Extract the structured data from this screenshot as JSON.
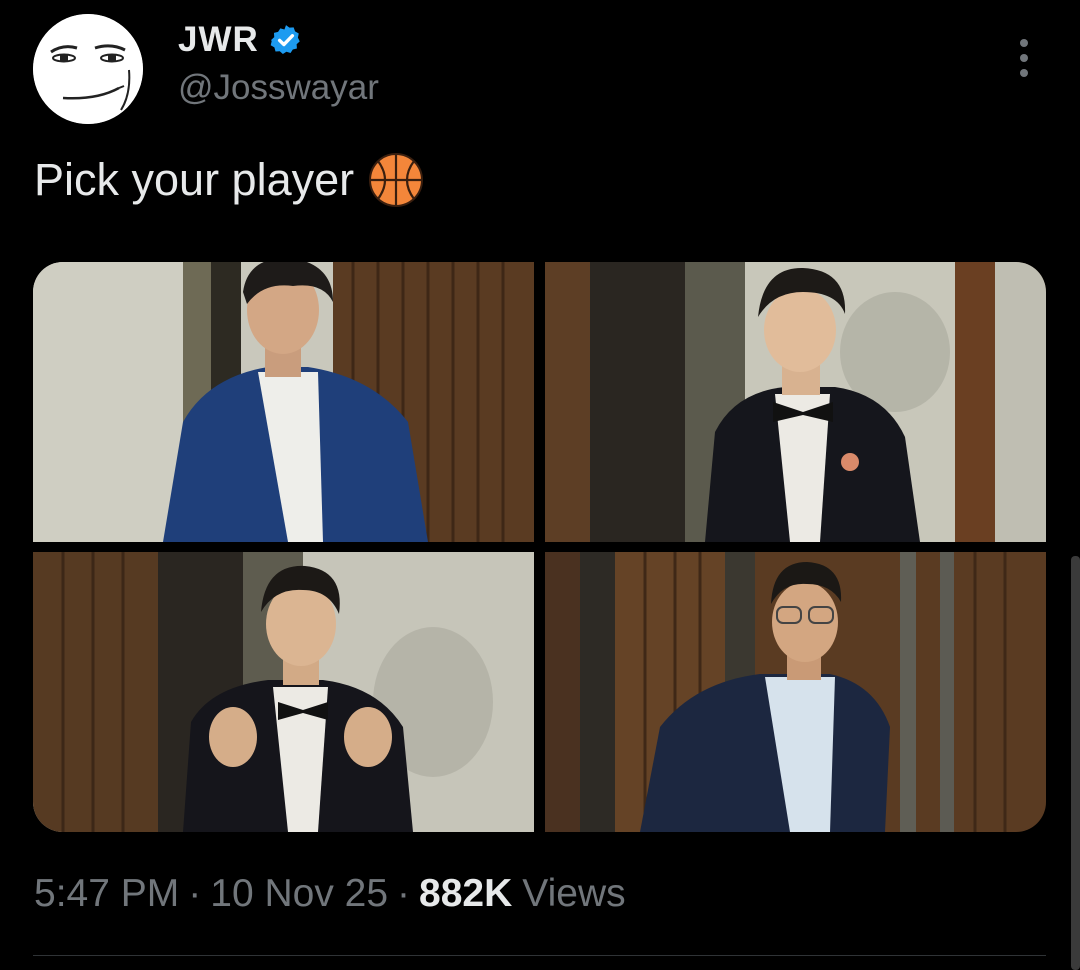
{
  "author": {
    "display_name": "JWR",
    "handle": "@Josswayar",
    "verified": true,
    "avatar_icon": "meme-face-avatar"
  },
  "tweet": {
    "text": "Pick your player",
    "emoji_icon": "basketball-icon",
    "media": [
      {
        "label": "player-1"
      },
      {
        "label": "player-2"
      },
      {
        "label": "player-3"
      },
      {
        "label": "player-4"
      }
    ]
  },
  "meta": {
    "time": "5:47 PM",
    "separator": "·",
    "date": "10 Nov 25",
    "views_count": "882K",
    "views_label": "Views"
  },
  "colors": {
    "background": "#000000",
    "text_primary": "#e7e9ea",
    "text_secondary": "#71767b",
    "verified_blue": "#1d9bf0",
    "divider": "#2f3336"
  }
}
